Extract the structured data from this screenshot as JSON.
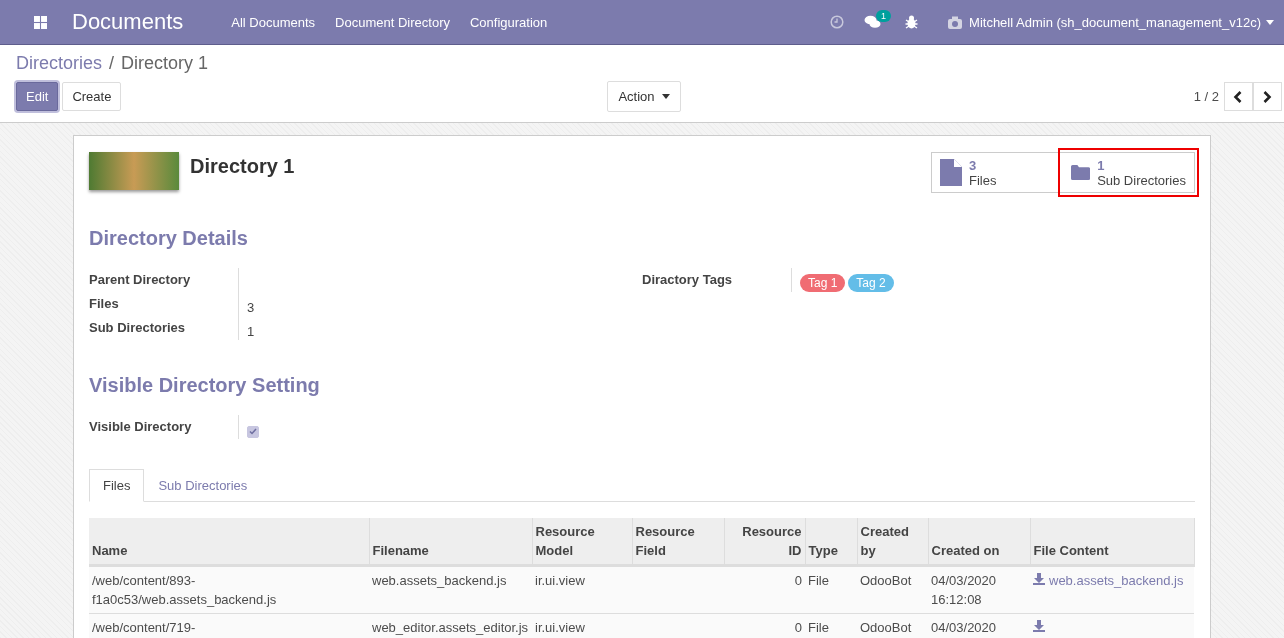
{
  "navbar": {
    "app_title": "Documents",
    "menu": [
      "All Documents",
      "Document Directory",
      "Configuration"
    ],
    "messages_badge": "1",
    "user": "Mitchell Admin (sh_document_management_v12c)"
  },
  "breadcrumb": {
    "parent": "Directories",
    "separator": "/",
    "current": "Directory 1"
  },
  "buttons": {
    "edit": "Edit",
    "create": "Create",
    "action": "Action"
  },
  "pager": "1 / 2",
  "record": {
    "title": "Directory 1",
    "stat_buttons": [
      {
        "kind": "file",
        "count": "3",
        "label": "Files",
        "highlighted": false
      },
      {
        "kind": "folder",
        "count": "1",
        "label": "Sub Directories",
        "highlighted": true
      }
    ]
  },
  "details": {
    "heading": "Directory Details",
    "fields": [
      {
        "label": "Parent Directory"
      },
      {
        "label": "Files",
        "value": "3"
      },
      {
        "label": "Sub Directories",
        "value": "1"
      }
    ],
    "tags_label": "Diractory Tags",
    "tags": [
      {
        "label": "Tag 1",
        "color": "#f06c73"
      },
      {
        "label": "Tag 2",
        "color": "#63bde8"
      }
    ]
  },
  "visibility": {
    "heading": "Visible Directory Setting",
    "label": "Visible Directory",
    "checked": true
  },
  "tabs": [
    {
      "label": "Files",
      "selected": true
    },
    {
      "label": "Sub Directories",
      "selected": false
    }
  ],
  "table": {
    "columns": [
      "Name",
      "Filename",
      "Resource Model",
      "Resource Field",
      "Resource ID",
      "Type",
      "Created by",
      "Created on",
      "File Content"
    ],
    "rows": [
      [
        "/web/content/893-f1a0c53/web.assets_backend.js",
        "web.assets_backend.js",
        "ir.ui.view",
        "",
        "0",
        "File",
        "OdooBot",
        "04/03/2020 16:12:08",
        "web.assets_backend.js"
      ],
      [
        "/web/content/719-",
        "web_editor.assets_editor.js",
        "ir.ui.view",
        "",
        "0",
        "File",
        "OdooBot",
        "04/03/2020",
        ""
      ]
    ]
  }
}
